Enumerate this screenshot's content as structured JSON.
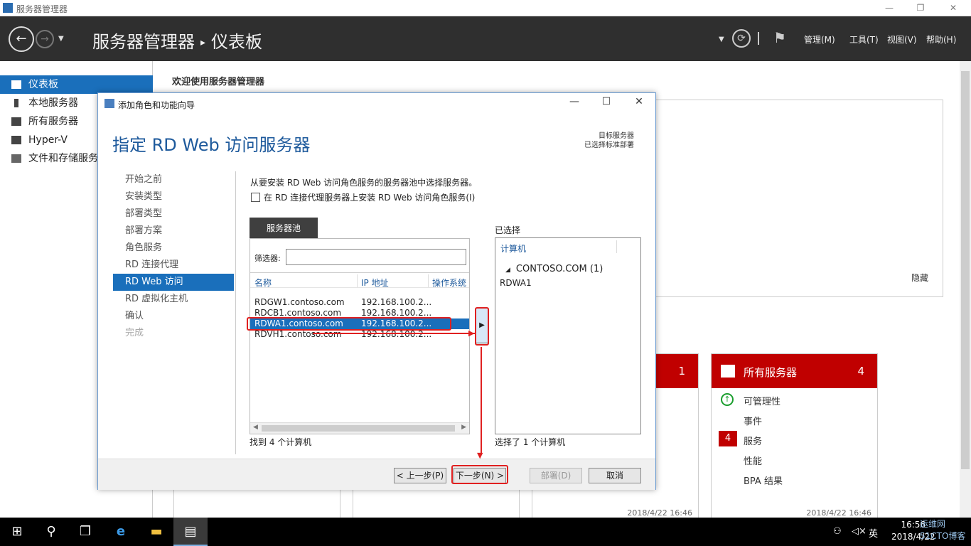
{
  "window": {
    "title": "服务器管理器",
    "controls": {
      "minimize": "—",
      "maximize": "❐",
      "close": "✕"
    }
  },
  "header": {
    "breadcrumb_root": "服务器管理器",
    "breadcrumb_sep": "▸",
    "breadcrumb_current": "仪表板",
    "menus": [
      "管理(M)",
      "工具(T)",
      "视图(V)",
      "帮助(H)"
    ]
  },
  "sidebar": {
    "items": [
      {
        "label": "仪表板",
        "active": true
      },
      {
        "label": "本地服务器"
      },
      {
        "label": "所有服务器"
      },
      {
        "label": "Hyper-V"
      },
      {
        "label": "文件和存储服务"
      }
    ]
  },
  "dashboard": {
    "welcome": "欢迎使用服务器管理器",
    "hide": "隐藏",
    "tile_left": {
      "count": "1",
      "date": "2018/4/22 16:46"
    },
    "tile_all": {
      "name": "所有服务器",
      "count": "4",
      "rows": [
        "可管理性",
        "事件",
        "服务",
        "性能",
        "BPA 结果"
      ],
      "services_badge": "4",
      "date": "2018/4/22 16:46"
    }
  },
  "dialog": {
    "title": "添加角色和功能向导",
    "heading": "指定 RD Web 访问服务器",
    "target_line1": "目标服务器",
    "target_line2": "已选择标准部署",
    "steps": [
      {
        "label": "开始之前",
        "state": "normal"
      },
      {
        "label": "安装类型",
        "state": "normal"
      },
      {
        "label": "部署类型",
        "state": "normal"
      },
      {
        "label": "部署方案",
        "state": "normal"
      },
      {
        "label": "角色服务",
        "state": "normal"
      },
      {
        "label": "RD 连接代理",
        "state": "normal"
      },
      {
        "label": "RD Web 访问",
        "state": "active"
      },
      {
        "label": "RD 虚拟化主机",
        "state": "normal"
      },
      {
        "label": "确认",
        "state": "normal"
      },
      {
        "label": "完成",
        "state": "disabled"
      }
    ],
    "description": "从要安装 RD Web 访问角色服务的服务器池中选择服务器。",
    "checkbox_label": "在 RD 连接代理服务器上安装 RD Web 访问角色服务(I)",
    "pool": {
      "tab": "服务器池",
      "filter_label": "筛选器:",
      "filter_value": "",
      "columns": [
        "名称",
        "IP 地址",
        "操作系统"
      ],
      "rows": [
        {
          "name": "RDGW1.contoso.com",
          "ip": "192.168.100.2..."
        },
        {
          "name": "RDCB1.contoso.com",
          "ip": "192.168.100.2..."
        },
        {
          "name": "RDWA1.contoso.com",
          "ip": "192.168.100.2...",
          "selected": true
        },
        {
          "name": "RDVH1.contoso.com",
          "ip": "192.168.100.2..."
        }
      ],
      "found": "找到 4 个计算机"
    },
    "add_button": "▶",
    "selected": {
      "label": "已选择",
      "column": "计算机",
      "group": "CONTOSO.COM (1)",
      "item": "RDWA1",
      "count": "选择了 1 个计算机"
    },
    "buttons": {
      "prev": "< 上一步(P)",
      "next": "下一步(N) >",
      "deploy": "部署(D)",
      "cancel": "取消"
    }
  },
  "taskbar": {
    "ime": "英",
    "clock_time": "16:56",
    "clock_date": "2018/4/22",
    "watermark_line1": "运维网",
    "watermark_line2": "51CTO博客"
  },
  "colors": {
    "accent": "#1a6fbb",
    "header": "#2f2f2f",
    "tile_red": "#c00000",
    "annotation": "#e02020"
  }
}
